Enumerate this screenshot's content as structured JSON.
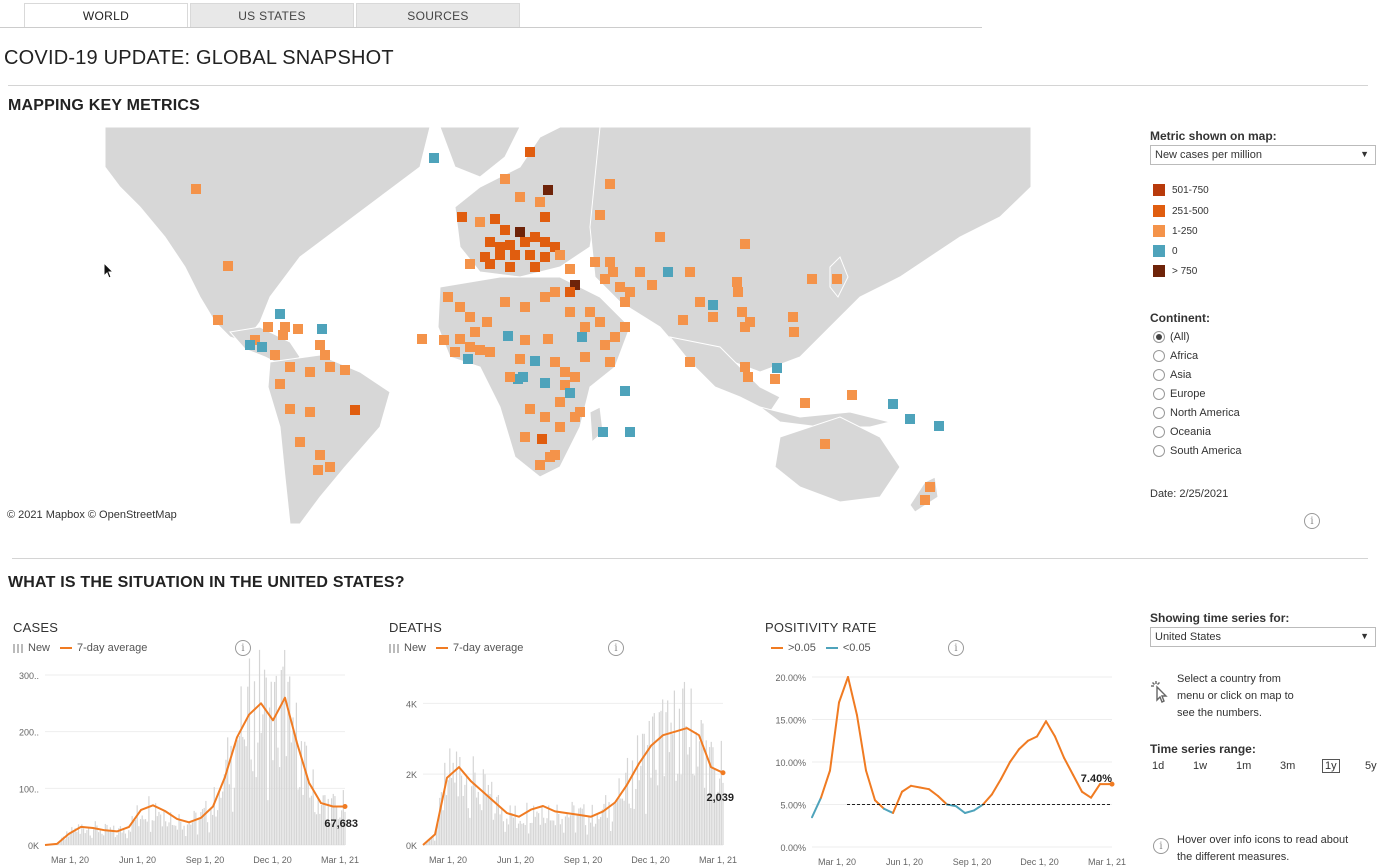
{
  "tabs": [
    "WORLD",
    "US STATES",
    "SOURCES"
  ],
  "page_title": "COVID-19 UPDATE: GLOBAL SNAPSHOT",
  "map_section": {
    "title": "MAPPING KEY METRICS",
    "attribution": "© 2021 Mapbox  © OpenStreetMap",
    "metric_label": "Metric shown on map:",
    "metric_value": "New cases per million",
    "legend": [
      {
        "label": "501-750",
        "color": "#b83a0b"
      },
      {
        "label": "251-500",
        "color": "#e05d0f"
      },
      {
        "label": "1-250",
        "color": "#f4934a"
      },
      {
        "label": "0",
        "color": "#4ea3bb"
      },
      {
        "label": "> 750",
        "color": "#6e2309"
      }
    ],
    "continent_label": "Continent:",
    "continents": [
      "(All)",
      "Africa",
      "Asia",
      "Europe",
      "North America",
      "Oceania",
      "South America"
    ],
    "continent_selected": "(All)",
    "date_text": "Date: 2/25/2021"
  },
  "us_section": {
    "title": "WHAT IS THE SITUATION IN THE UNITED STATES?",
    "showing_label": "Showing time series for:",
    "showing_value": "United States",
    "hint_text": [
      "Select a country from",
      "menu or click on map to",
      "see the numbers."
    ],
    "range_label": "Time series range:",
    "range_options": [
      "1d",
      "1w",
      "1m",
      "3m",
      "1y",
      "5y"
    ],
    "range_selected": "1y",
    "info_hint": [
      "Hover over info icons to read about",
      "the different measures."
    ]
  },
  "chart_data": [
    {
      "type": "area",
      "title": "CASES",
      "legend": [
        "New",
        "7-day average"
      ],
      "y_ticks": [
        "0K",
        "100..",
        "200..",
        "300.."
      ],
      "x_ticks": [
        "Mar 1, 20",
        "Jun 1, 20",
        "Sep 1, 20",
        "Dec 1, 20",
        "Mar 1, 21"
      ],
      "ylim": [
        0,
        300
      ],
      "series": [
        {
          "name": "7-day average",
          "x_index": [
            0,
            4,
            8,
            12,
            16,
            20,
            24,
            28,
            32,
            36,
            40,
            44,
            48,
            52,
            56,
            60,
            64,
            68,
            72,
            76,
            80,
            84,
            88,
            92,
            96,
            100
          ],
          "values": [
            0,
            2,
            20,
            32,
            30,
            26,
            24,
            32,
            62,
            70,
            60,
            46,
            40,
            48,
            68,
            120,
            190,
            230,
            250,
            220,
            260,
            180,
            110,
            74,
            68,
            68
          ]
        }
      ],
      "last_value_label": "67,683",
      "color": "#f07b22"
    },
    {
      "type": "area",
      "title": "DEATHS",
      "legend": [
        "New",
        "7-day average"
      ],
      "y_ticks": [
        "0K",
        "2K",
        "4K"
      ],
      "x_ticks": [
        "Mar 1, 20",
        "Jun 1, 20",
        "Sep 1, 20",
        "Dec 1, 20",
        "Mar 1, 21"
      ],
      "ylim": [
        0,
        4800
      ],
      "series": [
        {
          "name": "7-day average",
          "x_index": [
            0,
            4,
            8,
            12,
            16,
            20,
            24,
            28,
            32,
            36,
            40,
            44,
            48,
            52,
            56,
            60,
            64,
            68,
            72,
            76,
            80,
            84,
            88,
            92,
            96,
            100
          ],
          "values": [
            0,
            300,
            1900,
            2200,
            1800,
            1500,
            1200,
            900,
            800,
            1000,
            1100,
            950,
            900,
            850,
            800,
            950,
            1200,
            1700,
            2300,
            2800,
            3100,
            3200,
            3300,
            3100,
            2200,
            2039
          ]
        }
      ],
      "last_value_label": "2,039",
      "color": "#f07b22"
    },
    {
      "type": "line",
      "title": "POSITIVITY RATE",
      "legend": [
        ">0.05",
        "<0.05"
      ],
      "y_ticks": [
        "0.00%",
        "5.00%",
        "10.00%",
        "15.00%",
        "20.00%"
      ],
      "x_ticks": [
        "Mar 1, 20",
        "Jun 1, 20",
        "Sep 1, 20",
        "Dec 1, 20",
        "Mar 1, 21"
      ],
      "ylim": [
        0,
        20
      ],
      "threshold": 5,
      "series": [
        {
          "name": "positivity",
          "x_index": [
            0,
            3,
            6,
            9,
            12,
            15,
            18,
            21,
            24,
            27,
            30,
            33,
            36,
            39,
            42,
            45,
            48,
            51,
            54,
            57,
            60,
            63,
            66,
            69,
            72,
            75,
            78,
            81,
            84,
            87,
            90,
            93,
            96,
            99,
            100
          ],
          "values": [
            3.5,
            5.8,
            9,
            17,
            20,
            15.5,
            9,
            5.5,
            4.5,
            4,
            6.5,
            7.2,
            7,
            6.8,
            6,
            5,
            4.8,
            4,
            4.3,
            5,
            6.2,
            8,
            10,
            11.5,
            12.5,
            13,
            14.8,
            13,
            10.5,
            8.5,
            6.5,
            5.8,
            7.4,
            7.4,
            7.4
          ]
        }
      ],
      "last_value_label": "7.40%",
      "colors": {
        "above": "#f07b22",
        "below": "#4ea3bb"
      }
    }
  ]
}
